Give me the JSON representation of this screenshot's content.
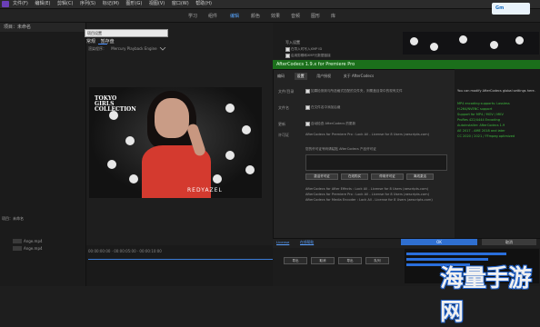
{
  "menubar": {
    "items": [
      "文件(F)",
      "编辑(E)",
      "剪辑(C)",
      "序列(S)",
      "标记(M)",
      "图形(G)",
      "视图(V)",
      "窗口(W)",
      "帮助(H)"
    ]
  },
  "workspaces": {
    "tabs": [
      "学习",
      "组件",
      "编辑",
      "颜色",
      "效果",
      "音频",
      "图形",
      "库"
    ],
    "active_index": 2
  },
  "corner_logo": "Gm",
  "project": {
    "title": "项目：未命名",
    "items": [
      "Ange.mp4",
      "Ange.mp4"
    ],
    "lower_title": "项目：未命名"
  },
  "source": {
    "header_title": "项目设置",
    "tabs": [
      "常规",
      "暂存盘"
    ],
    "option_label": "渲染程序：",
    "option_value": "Mercury Playback Engine",
    "video_text_tl": "TOKYO\nGIRLS\nCOLLECTION",
    "video_text_br": "REDYAZEL",
    "timeline_ticks": "00:00:00:00   ·   00:00:05:00   ·   00:00:10:00"
  },
  "right_panel": {
    "title": "写入设置",
    "checks": [
      "在导入时写入XMP ID",
      "启用剪辑和XMP元数据链接"
    ]
  },
  "dialog": {
    "title": "AfterCodecs 1.9.x for Premiere Pro",
    "tabs": [
      "编码",
      "设置",
      "用户授权",
      "关于 AfterCodecs"
    ],
    "active_tab": 1,
    "sections": [
      {
        "label": "文件/目录",
        "text": "如果检测到与所选格式匹配的文件夹，则覆盖目录中的现有文件"
      },
      {
        "label": "文件名",
        "text": "在文件名中添加后缀"
      },
      {
        "label": "更新",
        "text": "自动检查 AfterCodecs 的更新"
      },
      {
        "label": "许可证",
        "text": "AfterCodecs for Premiere Pro : Lock All - License for 8 Users (aescripts.com)"
      }
    ],
    "license_prompt": "您的许可证号码请粘贴 AfterCodecs 产品许可证",
    "buttons": [
      "激活许可证",
      "在线购买",
      "停用许可证",
      "离线激活"
    ],
    "ae_lines": [
      "AfterCodecs for After Effects : Lock All - License for 8 Users (aescripts.com)",
      "AfterCodecs for Premiere Pro : Lock All - License for 8 Users (aescripts.com)",
      "AfterCodecs for Media Encoder : Lock All - License for 8 Users (aescripts.com)"
    ],
    "license_link": "License",
    "website_link": "在线帮助",
    "ok": "OK",
    "cancel": "取消"
  },
  "sideinfo": {
    "lines": [
      {
        "text": "You can modify AfterCodecs global settings here.",
        "color": "#c8c8c8"
      },
      {
        "text": "MP4 encoding supports: Lossless",
        "color": "#3fbf3f"
      },
      {
        "text": "H.264/NVENC support",
        "color": "#3fbf3f"
      },
      {
        "text": "Support for MP4 / MOV / MKV",
        "color": "#3fbf3f"
      },
      {
        "text": "ProRes 422/4444 Encoding",
        "color": "#3fbf3f"
      },
      {
        "text": "Autoinstaller: AfterCodecs 1.9",
        "color": "#3fbf3f"
      },
      {
        "text": "AE 2017 - AME 2018 and later",
        "color": "#3fbf3f"
      },
      {
        "text": "CC 2020 / 2021 / FFmpeg optimized",
        "color": "#3fbf3f"
      }
    ]
  },
  "lower_buttons": [
    "导出",
    "取消",
    "导出",
    "队列",
    "元数据",
    "图形"
  ],
  "watermark": "海量手游网"
}
